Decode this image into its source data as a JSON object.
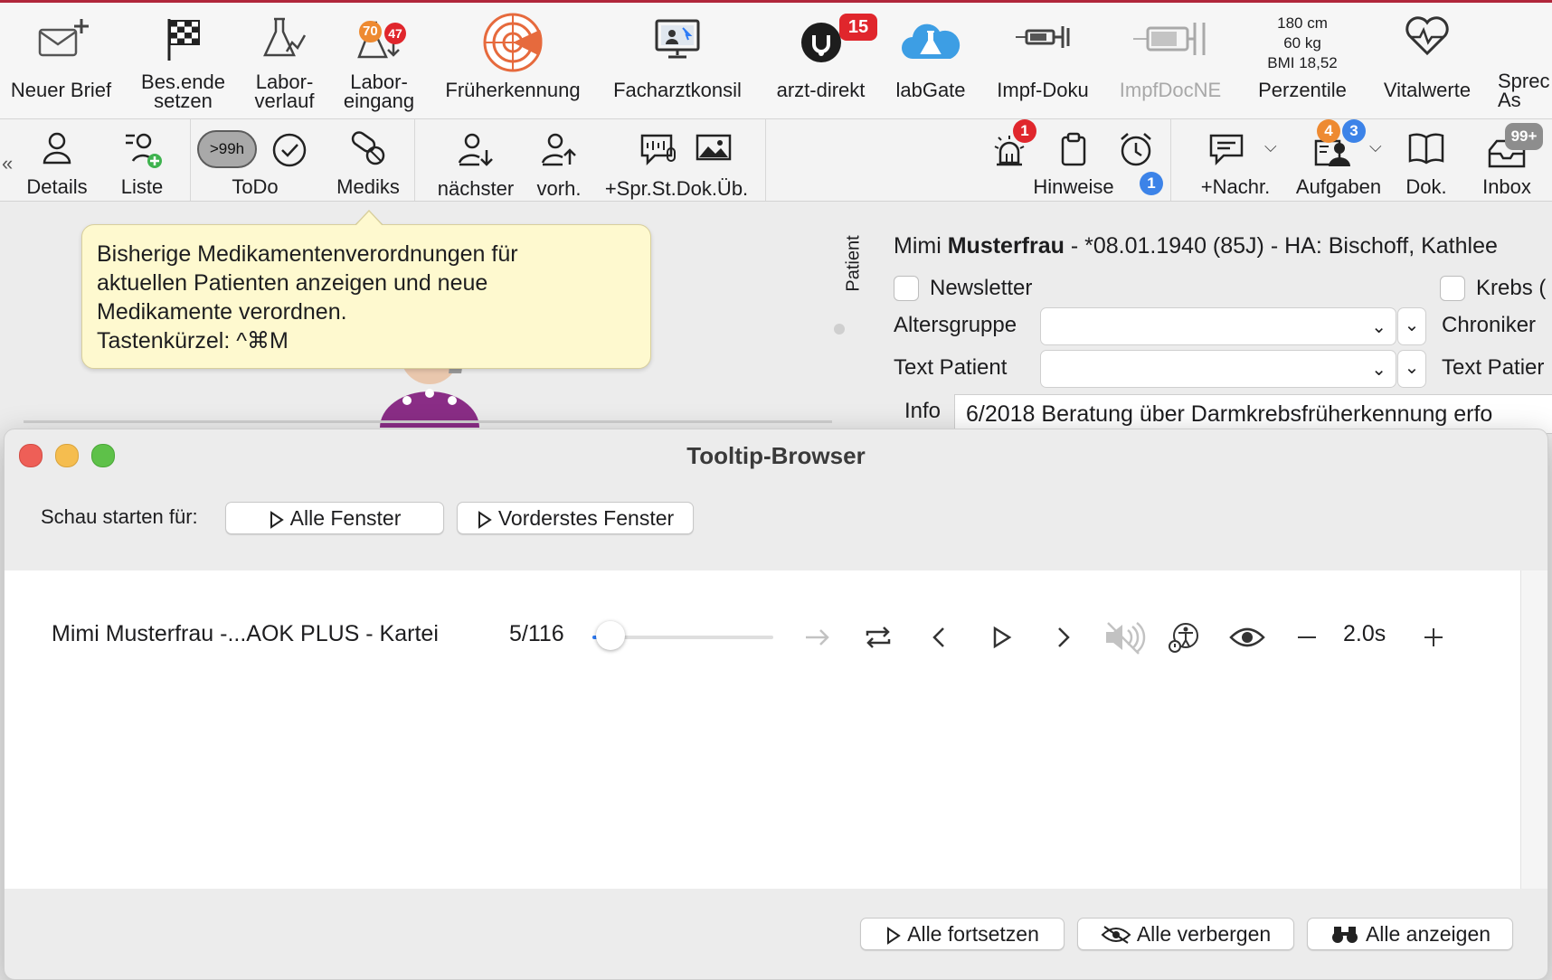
{
  "toolbar_top": {
    "items": [
      {
        "label": "Neuer Brief",
        "icon": "envelope-plus-icon"
      },
      {
        "label": "Bes.ende setzen",
        "icon": "checkered-flag-icon"
      },
      {
        "label": "Labor-verlauf",
        "icon": "lab-flask-chart-icon"
      },
      {
        "label": "Labor-eingang",
        "icon": "lab-flask-in-icon",
        "badge1": "70",
        "badge2": "47"
      },
      {
        "label": "Früherkennung",
        "icon": "radar-icon"
      },
      {
        "label": "Facharztkonsil",
        "icon": "monitor-consult-icon"
      },
      {
        "label": "arzt-direkt",
        "icon": "arzt-direkt-logo-icon",
        "badge": "15"
      },
      {
        "label": "labGate",
        "icon": "cloud-flask-icon"
      },
      {
        "label": "Impf-Doku",
        "icon": "syringe-icon"
      },
      {
        "label": "ImpfDocNE",
        "icon": "syringe-grey-icon"
      },
      {
        "label": "Perzentile",
        "lines": [
          "180 cm",
          "60 kg",
          "BMI 18,52"
        ]
      },
      {
        "label": "Vitalwerte",
        "icon": "heart-pulse-icon"
      },
      {
        "label": "Sprec As",
        "icon": "speech-icon"
      }
    ]
  },
  "toolbar_second": {
    "left": [
      {
        "label": "Details",
        "icon": "person-icon"
      },
      {
        "label": "Liste",
        "icon": "person-list-add-icon"
      }
    ],
    "todo": {
      "label": "ToDo",
      "pill": ">99h"
    },
    "mediks": {
      "label": "Mediks",
      "icon": "pills-icon"
    },
    "nav": [
      {
        "label": "nächster",
        "icon": "person-down-icon"
      },
      {
        "label": "vorh.",
        "icon": "person-up-icon"
      },
      {
        "label": "+Spr.St.Dok.Üb.",
        "icon": "speech-doc-icon"
      },
      {
        "label": "",
        "icon": "image-icon"
      }
    ],
    "right": [
      {
        "label": "",
        "icon": "alarm-light-icon",
        "badge": "1"
      },
      {
        "label": "Hinweise",
        "icon": "clipboard-icon"
      },
      {
        "label": "",
        "icon": "alarm-clock-icon",
        "badge": "1"
      },
      {
        "label": "+Nachr.",
        "icon": "chat-icon"
      },
      {
        "label": "Aufgaben",
        "icon": "tasks-icon",
        "badge1": "4",
        "badge2": "3"
      },
      {
        "label": "Dok.",
        "icon": "book-icon"
      },
      {
        "label": "Inbox",
        "icon": "inbox-icon",
        "badge": "99+"
      }
    ]
  },
  "tooltip": {
    "lines": [
      "Bisherige Medikamentenverordnungen für",
      "aktuellen Patienten anzeigen und neue",
      "Medikamente verordnen.",
      "Tastenkürzel: ^⌘M"
    ]
  },
  "patient_panel": {
    "side_label": "Patient",
    "name_prefix": "Mimi ",
    "name_bold": "Musterfrau",
    "name_suffix": " - *08.01.1940 (85J) - HA: Bischoff, Kathlee",
    "newsletter": "Newsletter",
    "krebs": "Krebs (",
    "altersgruppe": "Altersgruppe",
    "chroniker": "Chroniker",
    "text_patient": "Text Patient",
    "text_patient_right": "Text Patier",
    "info_label": "Info",
    "info_value": "6/2018 Beratung über Darmkrebsfrüherkennung erfo"
  },
  "tooltip_browser": {
    "title": "Tooltip-Browser",
    "start_label": "Schau starten für:",
    "btn_all_windows": "Alle Fenster",
    "btn_front_window": "Vorderstes Fenster",
    "track_name": "Mimi Musterfrau -...AOK PLUS - Kartei",
    "counter": "5/116",
    "progress": 0.04,
    "speed": "2.0s",
    "btn_continue_all": "Alle fortsetzen",
    "btn_hide_all": "Alle verbergen",
    "btn_show_all": "Alle anzeigen"
  },
  "colors": {
    "accent": "#2f7cf6",
    "close": "#ee5f57",
    "minimize": "#f5bd4f",
    "zoom": "#5ec149",
    "tooltip_bg": "#fef9cf"
  }
}
